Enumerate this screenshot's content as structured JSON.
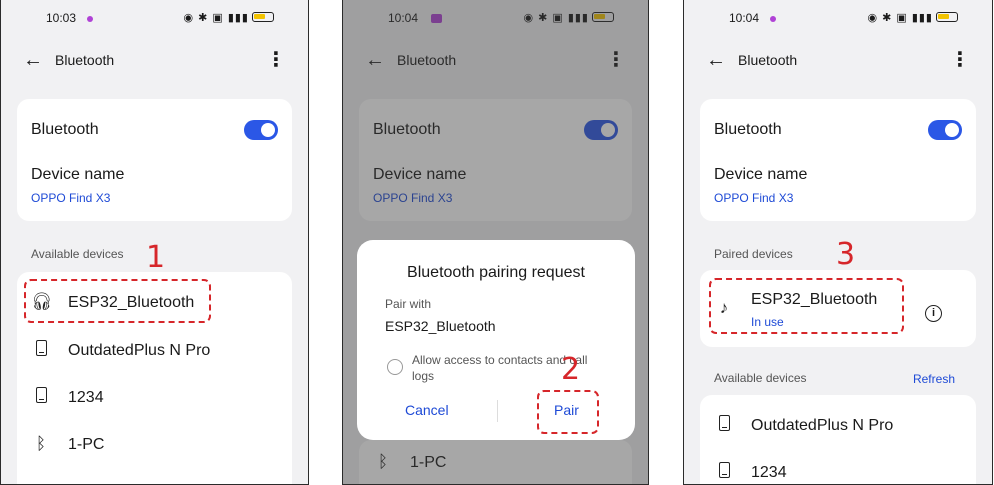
{
  "screens": [
    {
      "status": {
        "time": "10:03"
      },
      "appbar": {
        "title": "Bluetooth",
        "back_icon": "arrow-left-icon",
        "more_icon": "more-vertical-icon"
      },
      "settings": {
        "bluetooth_label": "Bluetooth",
        "device_name_label": "Device name",
        "device_name_value": "OPPO Find X3"
      },
      "available_label": "Available devices",
      "devices": [
        {
          "name": "ESP32_Bluetooth",
          "icon": "headphones-icon"
        },
        {
          "name": "OutdatedPlus N Pro",
          "icon": "phone-icon"
        },
        {
          "name": "1234",
          "icon": "phone-icon"
        },
        {
          "name": "1-PC",
          "icon": "bluetooth-icon"
        }
      ],
      "step_marker": "1"
    },
    {
      "status": {
        "time": "10:04"
      },
      "appbar": {
        "title": "Bluetooth"
      },
      "settings": {
        "bluetooth_label": "Bluetooth",
        "device_name_label": "Device name",
        "device_name_value": "OPPO Find X3"
      },
      "dialog": {
        "title": "Bluetooth pairing request",
        "pair_with_label": "Pair with",
        "device": "ESP32_Bluetooth",
        "checkbox_label": "Allow access to contacts and call logs",
        "cancel_label": "Cancel",
        "pair_label": "Pair"
      },
      "behind_device": {
        "name": "1-PC",
        "icon": "bluetooth-icon"
      },
      "step_marker": "2"
    },
    {
      "status": {
        "time": "10:04"
      },
      "appbar": {
        "title": "Bluetooth"
      },
      "settings": {
        "bluetooth_label": "Bluetooth",
        "device_name_label": "Device name",
        "device_name_value": "OPPO Find X3"
      },
      "paired_label": "Paired devices",
      "paired_device": {
        "name": "ESP32_Bluetooth",
        "status": "In use",
        "icon": "music-note-icon"
      },
      "available_label": "Available devices",
      "refresh_label": "Refresh",
      "devices": [
        {
          "name": "OutdatedPlus N Pro",
          "icon": "phone-icon"
        },
        {
          "name": "1234",
          "icon": "phone-icon"
        }
      ],
      "step_marker": "3"
    }
  ],
  "colors": {
    "accent": "#2b57e6",
    "link": "#1e4ad6",
    "annotation": "#d6262a"
  }
}
